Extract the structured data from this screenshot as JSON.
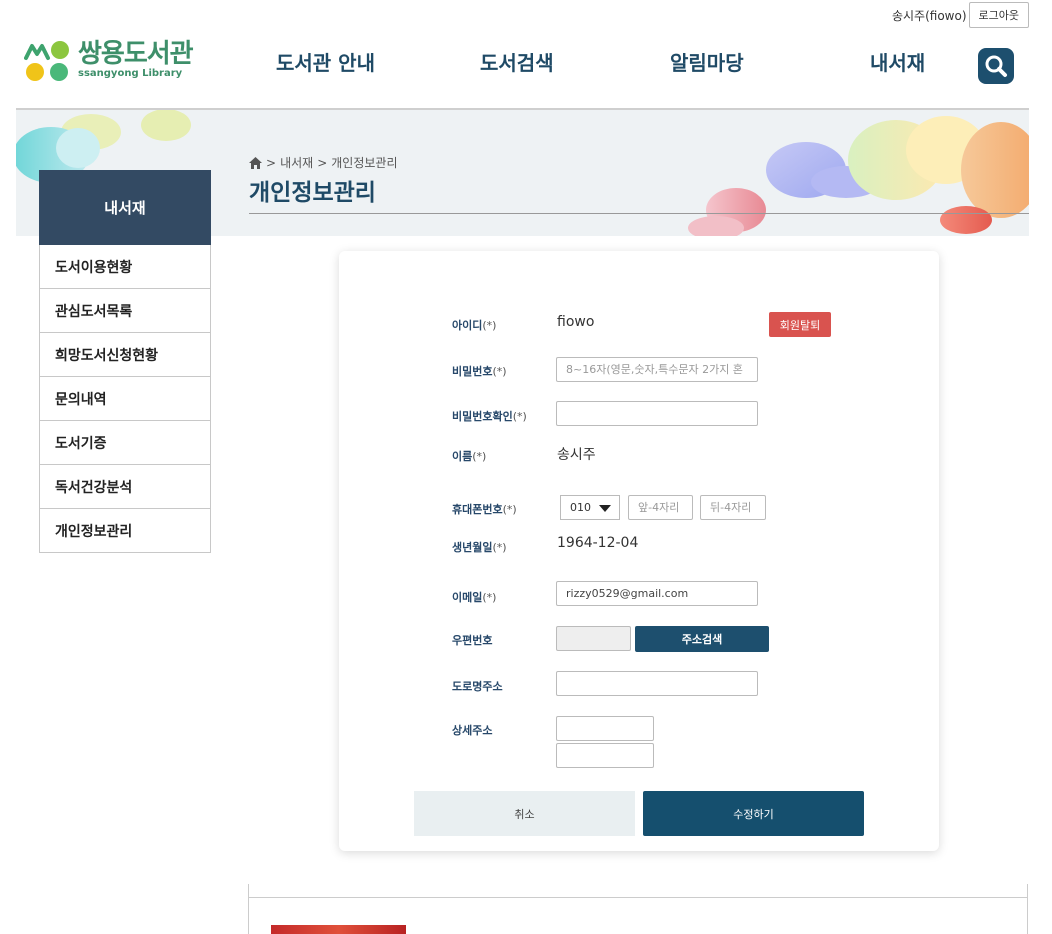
{
  "header": {
    "user_name": "송시주(fiowo)",
    "logout_label": "로그아웃",
    "logo_ko": "쌍용도서관",
    "logo_en": "ssangyong Library",
    "nav": [
      "도서관 안내",
      "도서검색",
      "알림마당",
      "내서재"
    ],
    "search_icon": "search-icon"
  },
  "banner": {
    "breadcrumb_home_icon": "home-icon",
    "breadcrumb": [
      "내서재",
      "개인정보관리"
    ],
    "title": "개인정보관리"
  },
  "sidebar": {
    "heading": "내서재",
    "items": [
      {
        "label": "도서이용현황"
      },
      {
        "label": "관심도서목록"
      },
      {
        "label": "희망도서신청현황"
      },
      {
        "label": "문의내역"
      },
      {
        "label": "도서기증"
      },
      {
        "label": "독서건강분석"
      },
      {
        "label": "개인정보관리"
      }
    ]
  },
  "form": {
    "required_mark": "(*)",
    "id_label": "아이디",
    "id_value": "fiowo",
    "withdraw_label": "회원탈퇴",
    "password_label": "비밀번호",
    "password_placeholder": "8~16자(영문,숫자,특수문자 2가지 혼",
    "password_confirm_label": "비밀번호확인",
    "name_label": "이름",
    "name_value": "송시주",
    "phone_label": "휴대폰번호",
    "phone_prefix": "010",
    "phone_mid_placeholder": "앞-4자리",
    "phone_last_placeholder": "뒤-4자리",
    "birth_label": "생년월일",
    "birth_value": "1964-12-04",
    "email_label": "이메일",
    "email_value": "rizzy0529@gmail.com",
    "zip_label": "우편번호",
    "address_search_label": "주소검색",
    "road_address_label": "도로명주소",
    "detail_address_label": "상세주소",
    "cancel_label": "취소",
    "submit_label": "수정하기"
  },
  "colors": {
    "primary": "#1d4f6e",
    "sidebar_head": "#334a63",
    "danger": "#d9534f",
    "logo_green": "#3e8f6a"
  }
}
